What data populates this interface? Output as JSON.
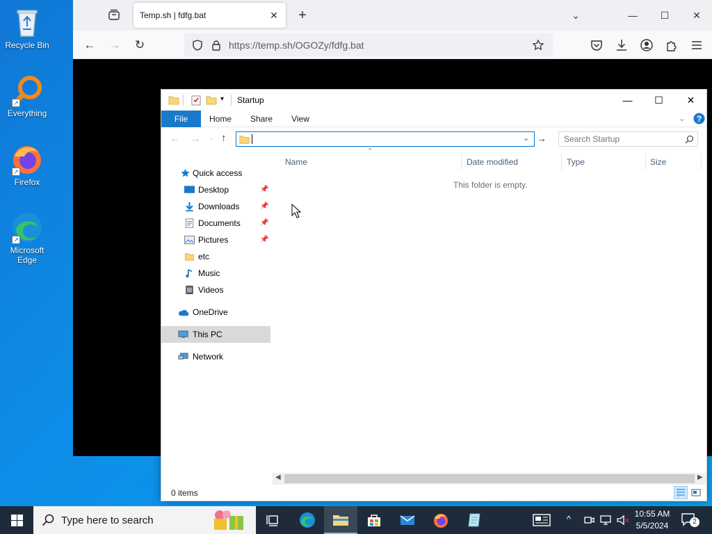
{
  "desktop": {
    "icons": [
      {
        "label": "Recycle Bin",
        "icon": "recycle-bin-icon"
      },
      {
        "label": "Everything",
        "icon": "everything-search-icon"
      },
      {
        "label": "Firefox",
        "icon": "firefox-icon"
      },
      {
        "label": "Microsoft Edge",
        "icon": "edge-icon"
      }
    ]
  },
  "browser": {
    "tab": {
      "title": "Temp.sh | fdfg.bat",
      "close": "✕"
    },
    "new_tab": "+",
    "url": "https://temp.sh/OGOZy/fdfg.bat",
    "window_controls": {
      "minimize": "—",
      "maximize": "☐",
      "close": "✕",
      "list_tabs": "⌄"
    }
  },
  "explorer": {
    "title": "Startup",
    "ribbon_tabs": [
      "File",
      "Home",
      "Share",
      "View"
    ],
    "search_placeholder": "Search Startup",
    "address_value": "",
    "nav_pane": [
      {
        "label": "Quick access",
        "icon": "star-icon",
        "pinned": false
      },
      {
        "label": "Desktop",
        "icon": "desktop-icon",
        "pinned": true
      },
      {
        "label": "Downloads",
        "icon": "downloads-icon",
        "pinned": true
      },
      {
        "label": "Documents",
        "icon": "documents-icon",
        "pinned": true
      },
      {
        "label": "Pictures",
        "icon": "pictures-icon",
        "pinned": true
      },
      {
        "label": "etc",
        "icon": "folder-icon",
        "pinned": false
      },
      {
        "label": "Music",
        "icon": "music-icon",
        "pinned": false
      },
      {
        "label": "Videos",
        "icon": "videos-icon",
        "pinned": false
      },
      {
        "label": "OneDrive",
        "icon": "onedrive-icon",
        "pinned": false
      },
      {
        "label": "This PC",
        "icon": "this-pc-icon",
        "pinned": false,
        "selected": true
      },
      {
        "label": "Network",
        "icon": "network-icon",
        "pinned": false
      }
    ],
    "columns": [
      "Name",
      "Date modified",
      "Type",
      "Size"
    ],
    "empty_message": "This folder is empty.",
    "status_count": "0 items",
    "window_controls": {
      "minimize": "—",
      "maximize": "☐",
      "close": "✕"
    }
  },
  "taskbar": {
    "search_placeholder": "Type here to search",
    "apps": [
      "task-view-icon",
      "edge-icon",
      "file-explorer-icon",
      "store-icon",
      "mail-icon",
      "firefox-icon",
      "notepad-icon"
    ],
    "active_app": "file-explorer-icon",
    "time": "10:55 AM",
    "date": "5/5/2024",
    "notifications": "2"
  },
  "colors": {
    "desktop": "#0d8ee8",
    "file_tab": "#1979ca",
    "taskbar": "#1e2b3a",
    "selection": "#d9d9d9"
  }
}
